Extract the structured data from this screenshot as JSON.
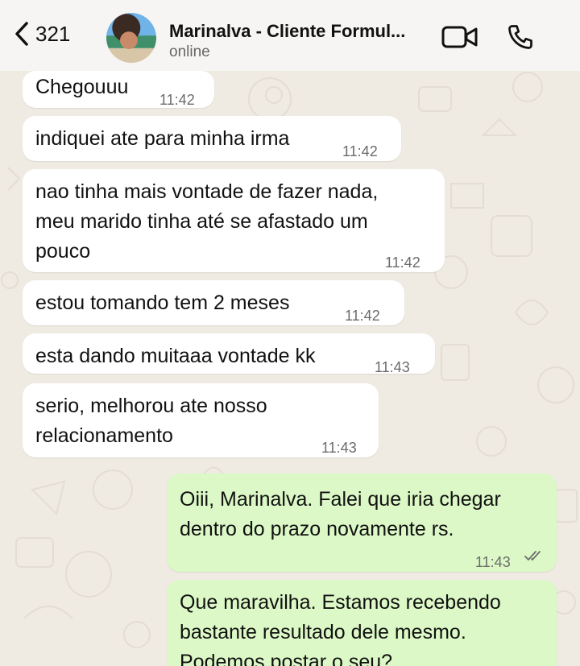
{
  "header": {
    "back_count": "321",
    "contact_name": "Marinalva - Cliente Formul...",
    "status": "online"
  },
  "messages": [
    {
      "text": "Chegouuu",
      "time": "11:42"
    },
    {
      "text": "indiquei ate para minha irma",
      "time": "11:42"
    },
    {
      "text": "nao tinha mais vontade de fazer nada,\nmeu marido tinha até se afastado um\npouco",
      "time": "11:42"
    },
    {
      "text": "estou tomando tem 2 meses",
      "time": "11:42"
    },
    {
      "text": "esta dando muitaaa vontade kk",
      "time": "11:43"
    },
    {
      "text": "serio, melhorou ate nosso\nrelacionamento",
      "time": "11:43"
    },
    {
      "text": "Oiii, Marinalva. Falei que iria chegar\ndentro do prazo novamente rs.",
      "time": "11:43"
    },
    {
      "text": "Que maravilha. Estamos recebendo\nbastante resultado dele mesmo.\nPodemos postar o seu?",
      "time": ""
    }
  ],
  "colors": {
    "incoming_bubble": "#ffffff",
    "outgoing_bubble": "#dbf8c6",
    "chat_background": "#efeae2"
  },
  "icons": [
    "chevron-left-icon",
    "video-camera-icon",
    "phone-icon",
    "double-check-icon"
  ]
}
